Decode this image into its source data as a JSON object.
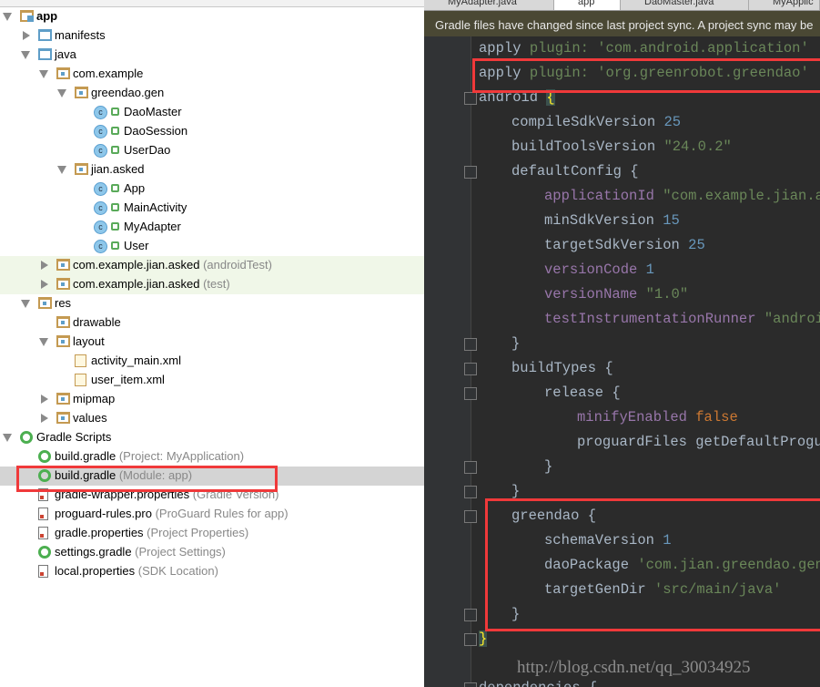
{
  "project_tree": {
    "items": [
      {
        "label": "app",
        "hint": "",
        "icon": "app-module-icon",
        "level": 0,
        "arrow": "down",
        "bold": true
      },
      {
        "label": "manifests",
        "hint": "",
        "icon": "folder-icon",
        "level": 1,
        "arrow": "right"
      },
      {
        "label": "java",
        "hint": "",
        "icon": "folder-icon",
        "level": 1,
        "arrow": "down"
      },
      {
        "label": "com.example",
        "hint": "",
        "icon": "package-icon",
        "level": 2,
        "arrow": "down"
      },
      {
        "label": "greendao.gen",
        "hint": "",
        "icon": "package-icon",
        "level": 3,
        "arrow": "down"
      },
      {
        "label": "DaoMaster",
        "hint": "",
        "icon": "class-icon",
        "level": 4,
        "arrow": ""
      },
      {
        "label": "DaoSession",
        "hint": "",
        "icon": "class-icon",
        "level": 4,
        "arrow": ""
      },
      {
        "label": "UserDao",
        "hint": "",
        "icon": "class-icon",
        "level": 4,
        "arrow": ""
      },
      {
        "label": "jian.asked",
        "hint": "",
        "icon": "package-icon",
        "level": 3,
        "arrow": "down"
      },
      {
        "label": "App",
        "hint": "",
        "icon": "class-icon",
        "level": 4,
        "arrow": ""
      },
      {
        "label": "MainActivity",
        "hint": "",
        "icon": "class-icon",
        "level": 4,
        "arrow": ""
      },
      {
        "label": "MyAdapter",
        "hint": "",
        "icon": "class-icon",
        "level": 4,
        "arrow": ""
      },
      {
        "label": "User",
        "hint": "",
        "icon": "class-icon",
        "level": 4,
        "arrow": ""
      },
      {
        "label": "com.example.jian.asked",
        "hint": " (androidTest)",
        "icon": "package-icon",
        "level": 2,
        "arrow": "right",
        "tinted": true
      },
      {
        "label": "com.example.jian.asked",
        "hint": " (test)",
        "icon": "package-icon",
        "level": 2,
        "arrow": "right",
        "tinted": true
      },
      {
        "label": "res",
        "hint": "",
        "icon": "package-icon",
        "level": 1,
        "arrow": "down"
      },
      {
        "label": "drawable",
        "hint": "",
        "icon": "package-icon",
        "level": 2,
        "arrow": ""
      },
      {
        "label": "layout",
        "hint": "",
        "icon": "package-icon",
        "level": 2,
        "arrow": "down"
      },
      {
        "label": "activity_main.xml",
        "hint": "",
        "icon": "xml-file-icon",
        "level": 3,
        "arrow": ""
      },
      {
        "label": "user_item.xml",
        "hint": "",
        "icon": "xml-file-icon",
        "level": 3,
        "arrow": ""
      },
      {
        "label": "mipmap",
        "hint": "",
        "icon": "package-icon",
        "level": 2,
        "arrow": "right"
      },
      {
        "label": "values",
        "hint": "",
        "icon": "package-icon",
        "level": 2,
        "arrow": "right"
      },
      {
        "label": "Gradle Scripts",
        "hint": "",
        "icon": "gradle-icon",
        "level": 0,
        "arrow": "down"
      },
      {
        "label": "build.gradle",
        "hint": " (Project: MyApplication)",
        "icon": "gradle-icon",
        "level": 1,
        "arrow": ""
      },
      {
        "label": "build.gradle",
        "hint": " (Module: app)",
        "icon": "gradle-icon",
        "level": 1,
        "arrow": "",
        "selected": true
      },
      {
        "label": "gradle-wrapper.properties",
        "hint": " (Gradle Version)",
        "icon": "properties-file-icon",
        "level": 1,
        "arrow": ""
      },
      {
        "label": "proguard-rules.pro",
        "hint": " (ProGuard Rules for app)",
        "icon": "properties-file-icon",
        "level": 1,
        "arrow": ""
      },
      {
        "label": "gradle.properties",
        "hint": " (Project Properties)",
        "icon": "properties-file-icon",
        "level": 1,
        "arrow": ""
      },
      {
        "label": "settings.gradle",
        "hint": " (Project Settings)",
        "icon": "gradle-icon",
        "level": 1,
        "arrow": ""
      },
      {
        "label": "local.properties",
        "hint": " (SDK Location)",
        "icon": "properties-file-icon",
        "level": 1,
        "arrow": ""
      }
    ]
  },
  "editor": {
    "tabs": [
      {
        "label": "MyAdapter.java",
        "active": false
      },
      {
        "label": "app",
        "active": true
      },
      {
        "label": "DaoMaster.java",
        "active": false
      },
      {
        "label": "MyApplic",
        "active": false
      }
    ],
    "notice": "Gradle files have changed since last project sync. A project sync may be",
    "lines": [
      {
        "indent": 0,
        "tokens": [
          [
            "k",
            "apply "
          ],
          [
            "s",
            "plugin: "
          ],
          [
            "s",
            "'com.android.application'"
          ]
        ]
      },
      {
        "indent": 0,
        "tokens": [
          [
            "k",
            "apply "
          ],
          [
            "s",
            "plugin: "
          ],
          [
            "s",
            "'org.greenrobot.greendao'"
          ]
        ]
      },
      {
        "indent": 0,
        "fold": true,
        "tokens": [
          [
            "k",
            "android "
          ],
          [
            "b",
            "{"
          ]
        ]
      },
      {
        "indent": 1,
        "tokens": [
          [
            "k",
            "compileSdkVersion "
          ],
          [
            "n",
            "25"
          ]
        ]
      },
      {
        "indent": 1,
        "tokens": [
          [
            "k",
            "buildToolsVersion "
          ],
          [
            "s",
            "\"24.0.2\""
          ]
        ]
      },
      {
        "indent": 1,
        "fold": true,
        "tokens": [
          [
            "k",
            "defaultConfig {"
          ]
        ]
      },
      {
        "indent": 2,
        "tokens": [
          [
            "p",
            "applicationId "
          ],
          [
            "s",
            "\"com.example.jian.asked\""
          ]
        ]
      },
      {
        "indent": 2,
        "tokens": [
          [
            "k",
            "minSdkVersion "
          ],
          [
            "n",
            "15"
          ]
        ]
      },
      {
        "indent": 2,
        "tokens": [
          [
            "k",
            "targetSdkVersion "
          ],
          [
            "n",
            "25"
          ]
        ]
      },
      {
        "indent": 2,
        "tokens": [
          [
            "p",
            "versionCode "
          ],
          [
            "n",
            "1"
          ]
        ]
      },
      {
        "indent": 2,
        "tokens": [
          [
            "p",
            "versionName "
          ],
          [
            "s",
            "\"1.0\""
          ]
        ]
      },
      {
        "indent": 2,
        "tokens": [
          [
            "p",
            "testInstrumentationRunner "
          ],
          [
            "s",
            "\"android.support.test.runner.AndroidJUnitRunner\""
          ]
        ]
      },
      {
        "indent": 1,
        "fold": true,
        "tokens": [
          [
            "k",
            "}"
          ]
        ]
      },
      {
        "indent": 1,
        "fold": true,
        "tokens": [
          [
            "k",
            "buildTypes {"
          ]
        ]
      },
      {
        "indent": 2,
        "fold": true,
        "tokens": [
          [
            "k",
            "release {"
          ]
        ]
      },
      {
        "indent": 3,
        "tokens": [
          [
            "p",
            "minifyEnabled "
          ],
          [
            "o",
            "false"
          ]
        ]
      },
      {
        "indent": 3,
        "tokens": [
          [
            "k",
            "proguardFiles getDefaultProguardFile"
          ]
        ]
      },
      {
        "indent": 2,
        "fold": true,
        "tokens": [
          [
            "k",
            "}"
          ]
        ]
      },
      {
        "indent": 1,
        "fold": true,
        "tokens": [
          [
            "k",
            "}"
          ]
        ]
      },
      {
        "indent": 1,
        "fold": true,
        "tokens": [
          [
            "k",
            "greendao {"
          ]
        ]
      },
      {
        "indent": 2,
        "tokens": [
          [
            "k",
            "schemaVersion "
          ],
          [
            "n",
            "1"
          ]
        ]
      },
      {
        "indent": 2,
        "tokens": [
          [
            "k",
            "daoPackage "
          ],
          [
            "s",
            "'com.jian.greendao.gen'"
          ]
        ]
      },
      {
        "indent": 2,
        "tokens": [
          [
            "k",
            "targetGenDir "
          ],
          [
            "s",
            "'src/main/java'"
          ]
        ]
      },
      {
        "indent": 1,
        "fold": true,
        "tokens": [
          [
            "k",
            "}"
          ]
        ]
      },
      {
        "indent": 0,
        "fold": true,
        "tokens": [
          [
            "b",
            "}"
          ]
        ]
      },
      {
        "indent": 0,
        "tokens": []
      },
      {
        "indent": 0,
        "fold": true,
        "tokens": [
          [
            "k",
            "dependencies {"
          ]
        ]
      }
    ],
    "watermark": "http://blog.csdn.net/qq_30034925"
  },
  "highlight_color": "#f0393a"
}
